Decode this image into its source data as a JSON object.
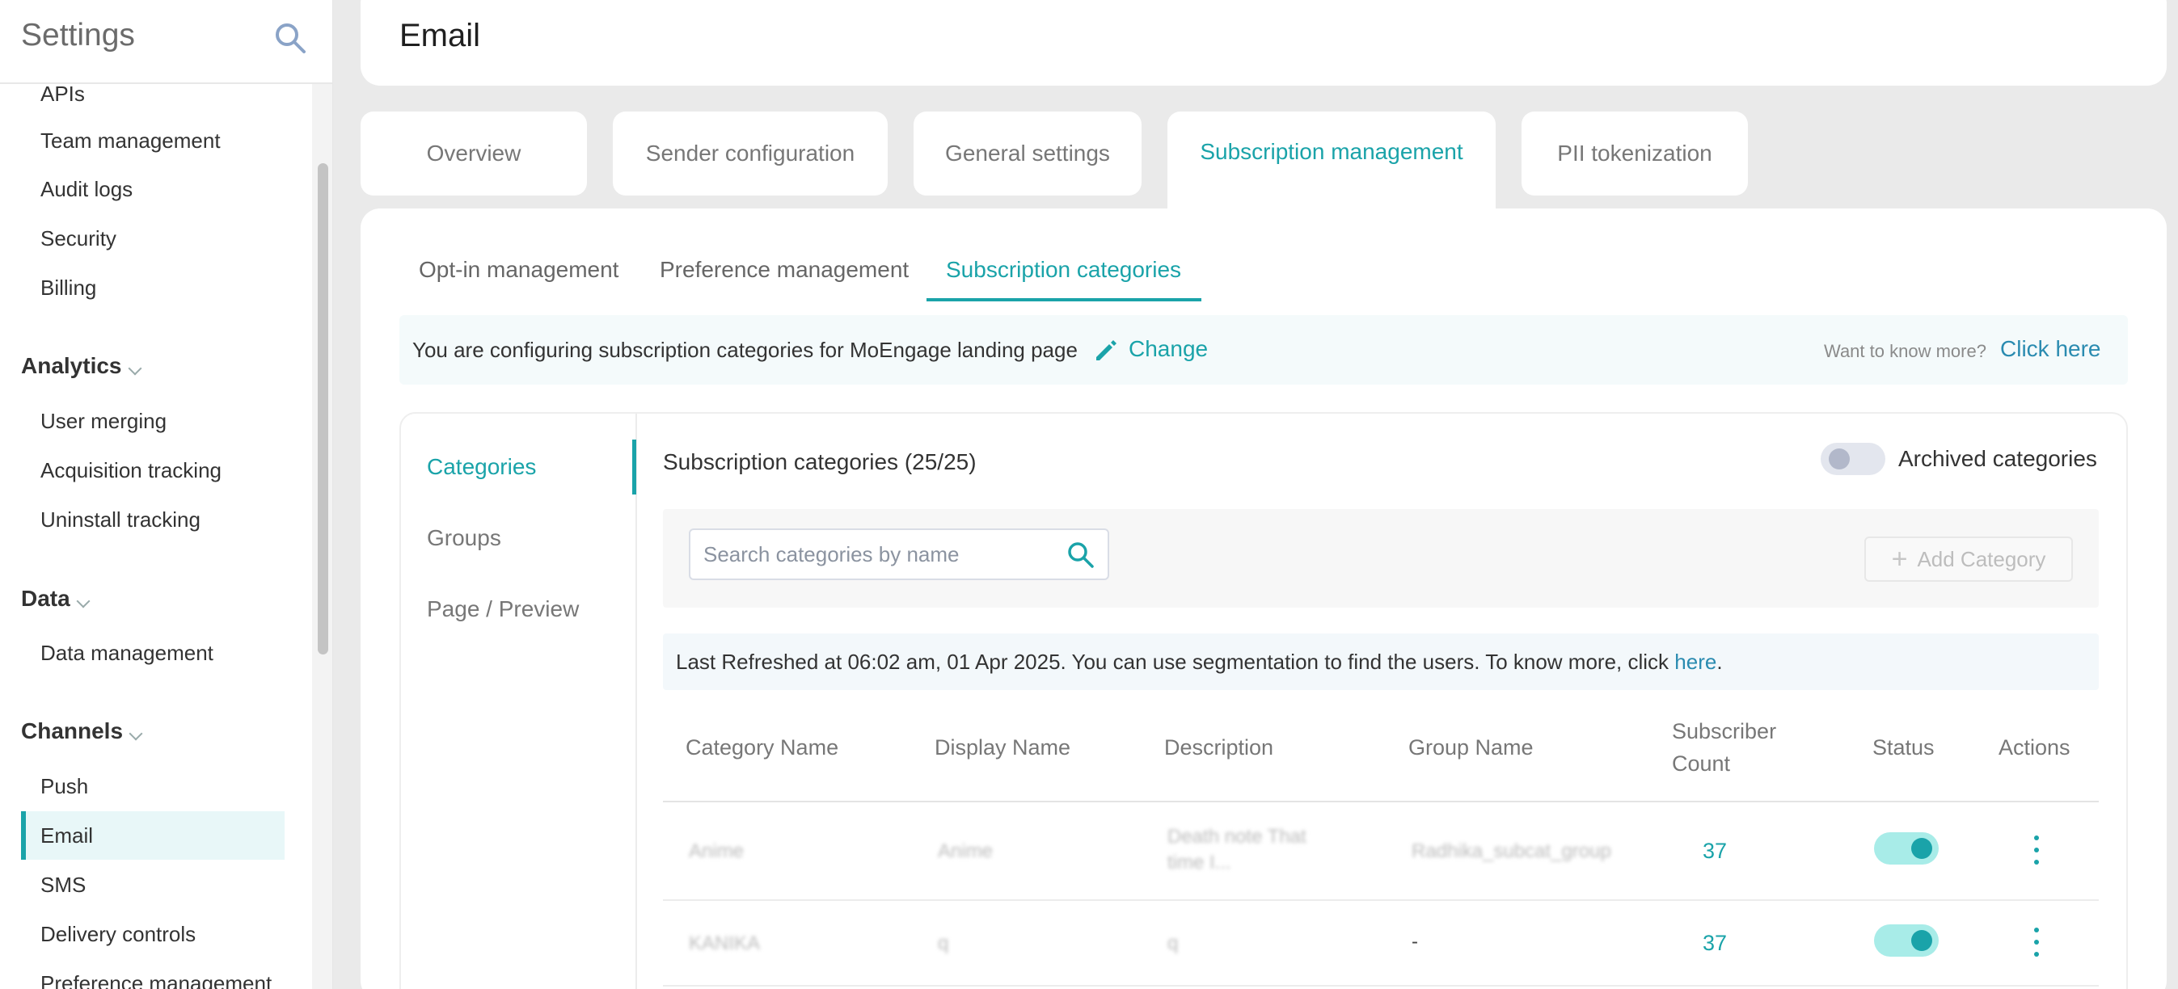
{
  "sidebar": {
    "title": "Settings",
    "items": {
      "apis": "APIs",
      "team_management": "Team management",
      "audit_logs": "Audit logs",
      "security": "Security",
      "billing": "Billing",
      "analytics": "Analytics",
      "user_merging": "User merging",
      "acquisition_tracking": "Acquisition tracking",
      "uninstall_tracking": "Uninstall tracking",
      "data": "Data",
      "data_management": "Data management",
      "channels": "Channels",
      "push": "Push",
      "email": "Email",
      "sms": "SMS",
      "delivery_controls": "Delivery controls",
      "preference_management": "Preference management"
    }
  },
  "header": {
    "title": "Email"
  },
  "tabs": {
    "overview": "Overview",
    "sender_configuration": "Sender configuration",
    "general_settings": "General settings",
    "subscription_management": "Subscription management",
    "pii_tokenization": "PII tokenization"
  },
  "subtabs": {
    "opt_in": "Opt-in management",
    "preference": "Preference management",
    "categories": "Subscription categories"
  },
  "info": {
    "text": "You are configuring subscription categories for MoEngage landing page",
    "change": "Change",
    "want_more": "Want to know more?",
    "click_here": "Click here"
  },
  "left_nav": {
    "categories": "Categories",
    "groups": "Groups",
    "page_preview": "Page / Preview"
  },
  "panel": {
    "heading": "Subscription categories (25/25)",
    "archived_label": "Archived categories",
    "search_placeholder": "Search categories by name",
    "add_category": "Add Category",
    "refresh_text": "Last Refreshed at 06:02 am, 01 Apr 2025. You can use segmentation to find the users. To know more, click ",
    "refresh_link": "here",
    "refresh_end": "."
  },
  "table": {
    "headers": {
      "category_name": "Category Name",
      "display_name": "Display Name",
      "description": "Description",
      "group_name": "Group Name",
      "subscriber_count_1": "Subscriber",
      "subscriber_count_2": "Count",
      "status": "Status",
      "actions": "Actions"
    },
    "rows": [
      {
        "category": "Anime",
        "display": "Anime",
        "description_1": "Death note That",
        "description_2": "time I...",
        "group": "Radhika_subcat_group",
        "count": "37"
      },
      {
        "category": "KANIKA",
        "display": "q",
        "description_1": "q",
        "group": "-",
        "count": "37"
      }
    ]
  },
  "colors": {
    "accent": "#1aa3a9",
    "link": "#2a8bb0"
  }
}
